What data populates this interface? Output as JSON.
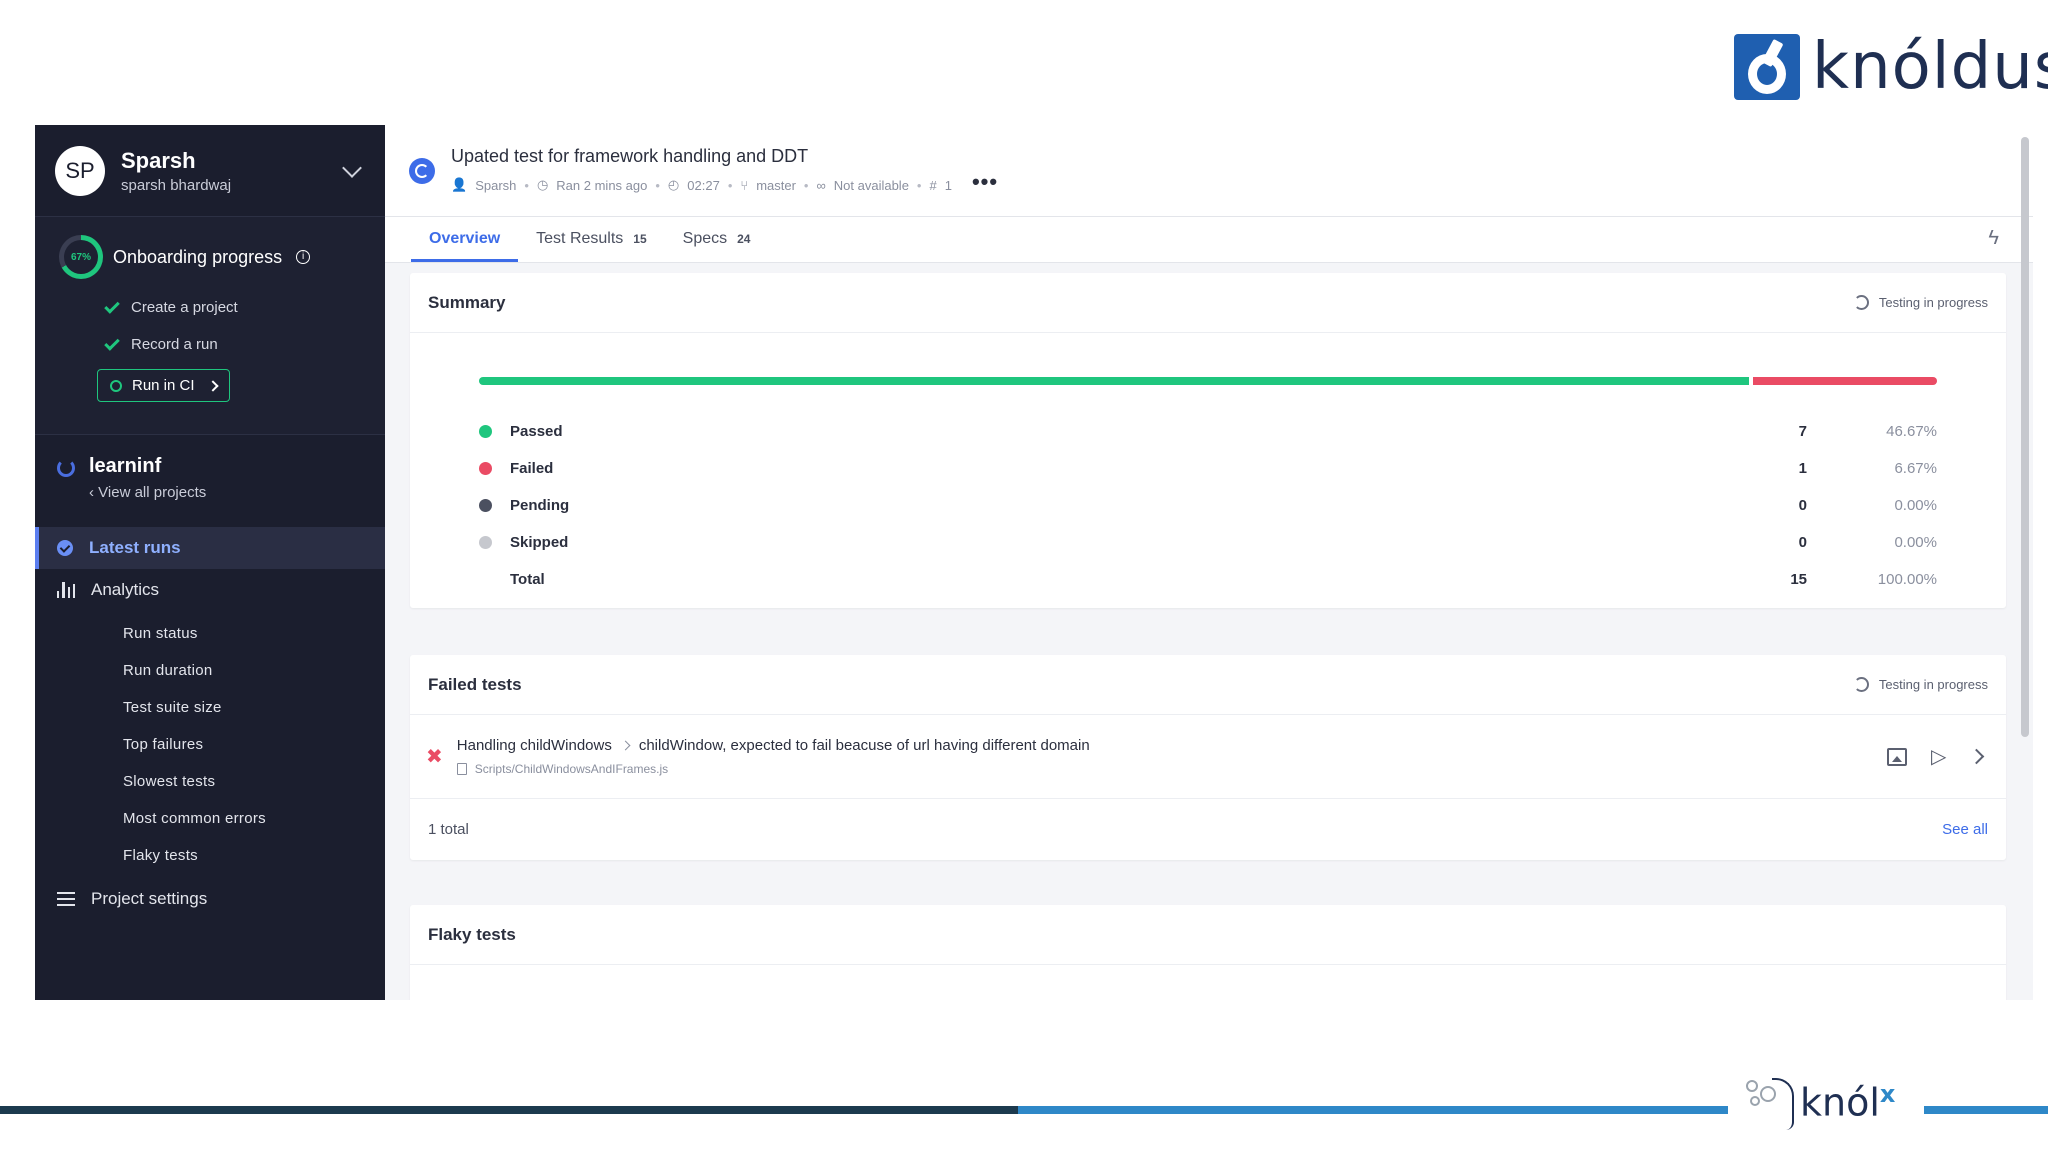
{
  "brand": {
    "logo_text": "knóldus"
  },
  "sidebar": {
    "user": {
      "initials": "SP",
      "name": "Sparsh",
      "handle": "sparsh bhardwaj"
    },
    "onboarding": {
      "percent_label": "67%",
      "percent": 67,
      "title": "Onboarding progress",
      "steps": [
        {
          "label": "Create a project",
          "done": true
        },
        {
          "label": "Record a run",
          "done": true
        }
      ],
      "cta": "Run in CI"
    },
    "project": {
      "name": "learninf",
      "link": "View all projects"
    },
    "nav": {
      "latest_runs": "Latest runs",
      "analytics": "Analytics",
      "analytics_items": [
        "Run status",
        "Run duration",
        "Test suite size",
        "Top failures",
        "Slowest tests",
        "Most common errors",
        "Flaky tests"
      ],
      "project_settings": "Project settings"
    }
  },
  "run": {
    "title": "Upated test for framework handling and DDT",
    "meta": {
      "author": "Sparsh",
      "ran": "Ran 2 mins ago",
      "duration": "02:27",
      "branch": "master",
      "link": "Not available",
      "number": "1"
    }
  },
  "tabs": [
    {
      "label": "Overview",
      "count": ""
    },
    {
      "label": "Test Results",
      "count": "15"
    },
    {
      "label": "Specs",
      "count": "24"
    }
  ],
  "summary": {
    "title": "Summary",
    "status": "Testing in progress",
    "passed_fraction": 0.8733,
    "rows": [
      {
        "label": "Passed",
        "count": "7",
        "pct": "46.67%",
        "color": "#1fc67e"
      },
      {
        "label": "Failed",
        "count": "1",
        "pct": "6.67%",
        "color": "#ea4b64"
      },
      {
        "label": "Pending",
        "count": "0",
        "pct": "0.00%",
        "color": "#4b5060"
      },
      {
        "label": "Skipped",
        "count": "0",
        "pct": "0.00%",
        "color": "#c6c8ce"
      },
      {
        "label": "Total",
        "count": "15",
        "pct": "100.00%",
        "color": ""
      }
    ]
  },
  "failed": {
    "title": "Failed tests",
    "status": "Testing in progress",
    "items": [
      {
        "suite": "Handling childWindows",
        "test": "childWindow, expected to fail beacuse of url having different domain",
        "file": "Scripts/ChildWindowsAndIFrames.js"
      }
    ],
    "total": "1 total",
    "see_all": "See all"
  },
  "flaky": {
    "title": "Flaky tests"
  }
}
